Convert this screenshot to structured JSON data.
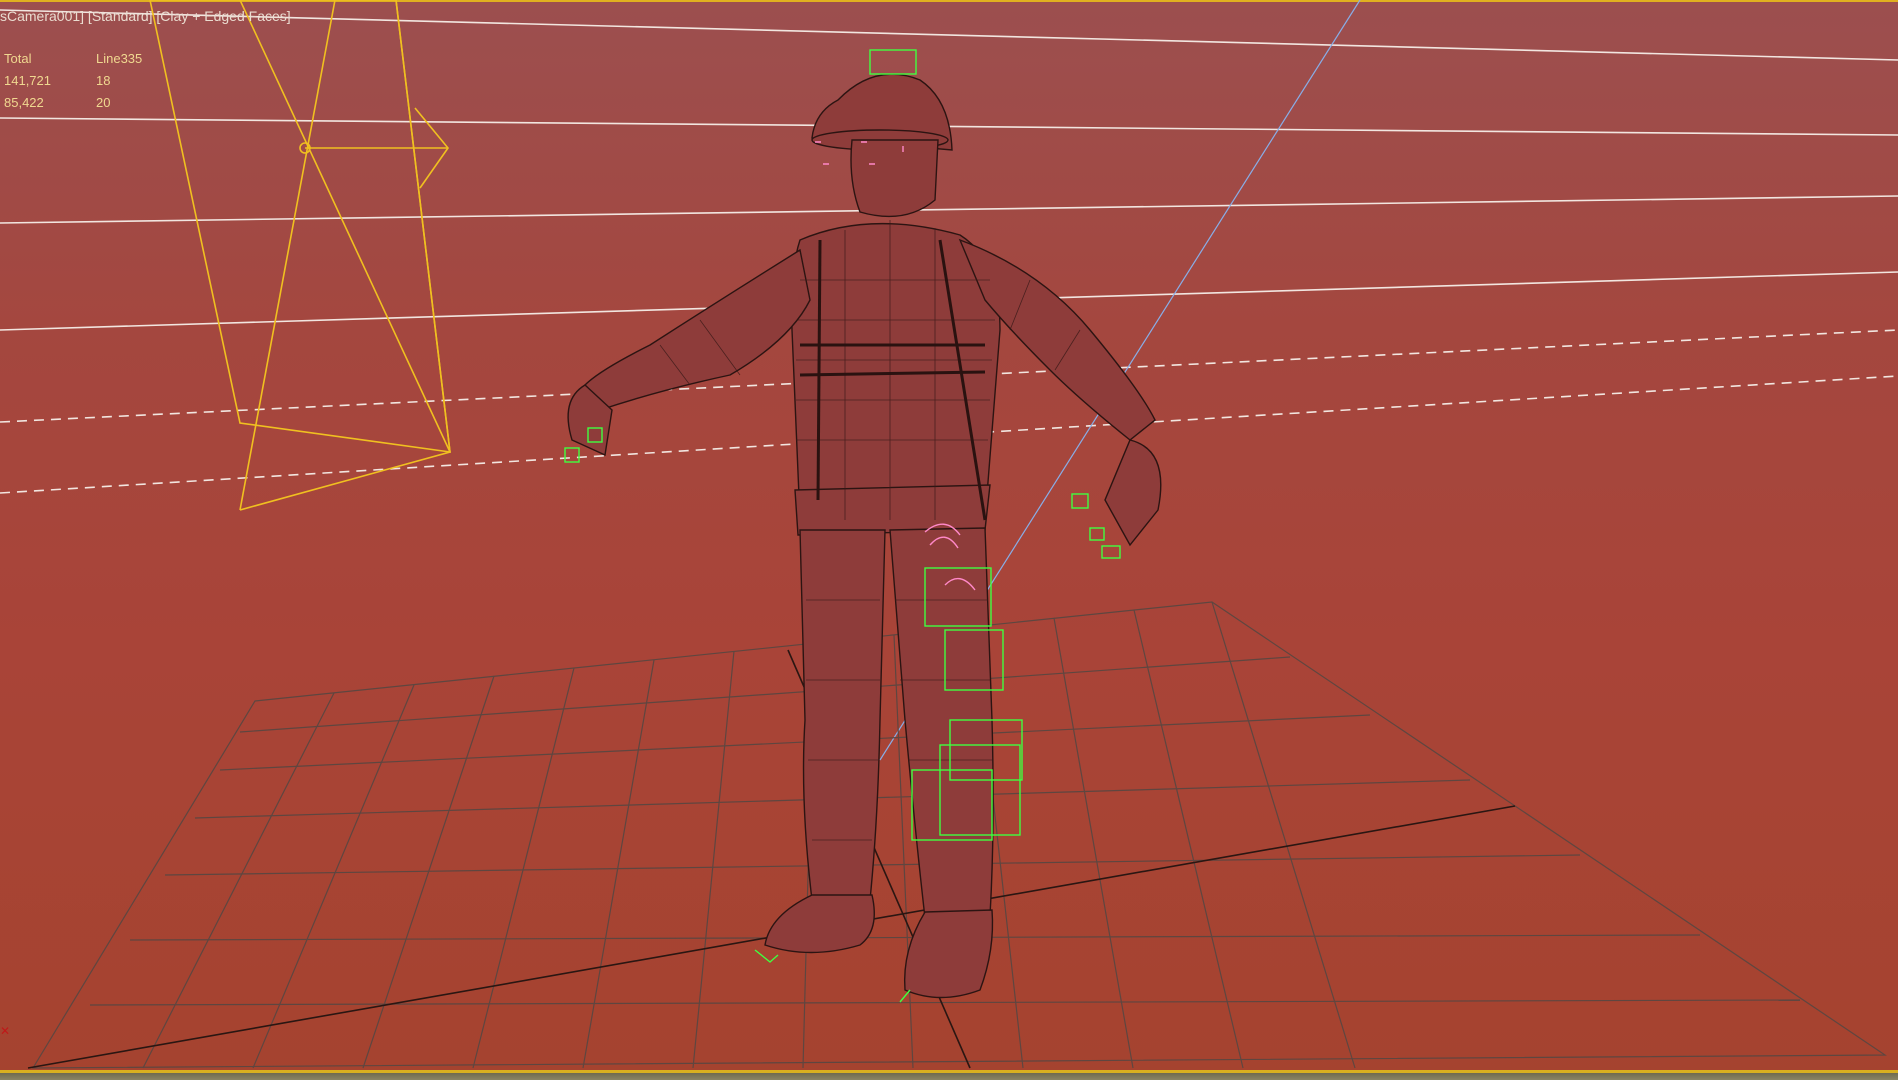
{
  "viewport": {
    "label": "sCamera001] [Standard] [Clay + Edged Faces]"
  },
  "stats": {
    "headers": [
      "Total",
      "Line335"
    ],
    "rows": [
      [
        "141,721",
        "18"
      ],
      [
        "85,422",
        "20"
      ]
    ]
  },
  "colors": {
    "background": "#a4473f",
    "camera_gizmo": "#f0c020",
    "bones": "#40ff40",
    "selection": "#ff88c8",
    "grid": "#5e4640"
  }
}
